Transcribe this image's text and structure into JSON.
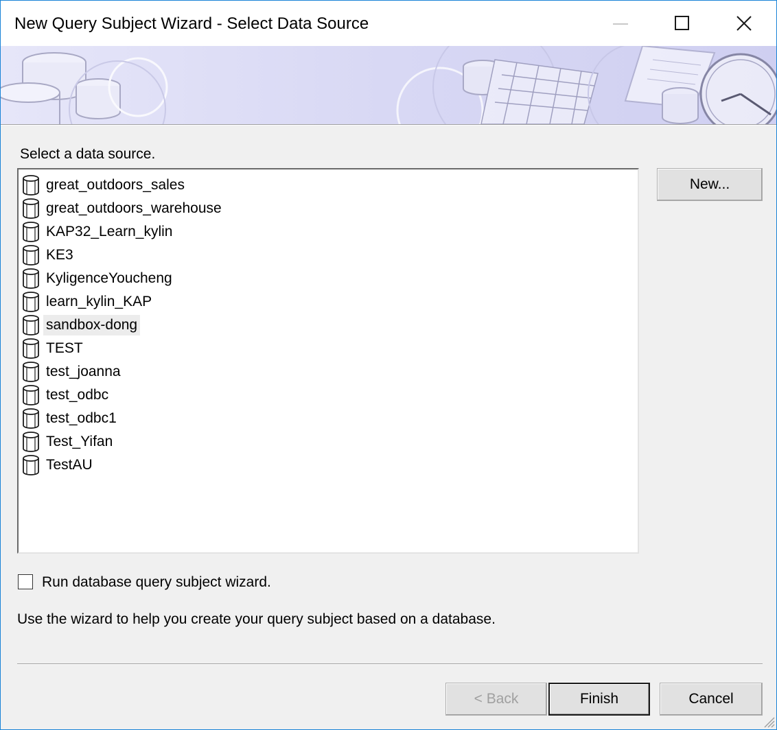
{
  "window": {
    "title": "New Query Subject Wizard - Select Data Source"
  },
  "main": {
    "prompt": "Select a data source.",
    "data_sources": [
      {
        "label": "great_outdoors_sales",
        "selected": false
      },
      {
        "label": "great_outdoors_warehouse",
        "selected": false
      },
      {
        "label": "KAP32_Learn_kylin",
        "selected": false
      },
      {
        "label": "KE3",
        "selected": false
      },
      {
        "label": "KyligenceYoucheng",
        "selected": false
      },
      {
        "label": "learn_kylin_KAP",
        "selected": false
      },
      {
        "label": "sandbox-dong",
        "selected": true
      },
      {
        "label": "TEST",
        "selected": false
      },
      {
        "label": "test_joanna",
        "selected": false
      },
      {
        "label": "test_odbc",
        "selected": false
      },
      {
        "label": "test_odbc1",
        "selected": false
      },
      {
        "label": "Test_Yifan",
        "selected": false
      },
      {
        "label": "TestAU",
        "selected": false
      }
    ],
    "new_button": "New...",
    "run_wizard_checkbox": {
      "label": "Run database query subject wizard.",
      "checked": false
    },
    "description": "Use the wizard to help you create your query subject based on a database."
  },
  "footer": {
    "back_button": "< Back",
    "finish_button": "Finish",
    "cancel_button": "Cancel"
  },
  "icons": {
    "list_item_icon": "database-icon",
    "minimize": "minimize-icon",
    "maximize": "maximize-icon",
    "close": "close-icon"
  },
  "colors": {
    "window_border": "#1883d7",
    "dialog_background": "#f0f0f0",
    "banner_tint": "#d8d8f4",
    "selected_item": "#ececec",
    "disabled_text": "#a0a0a0"
  }
}
